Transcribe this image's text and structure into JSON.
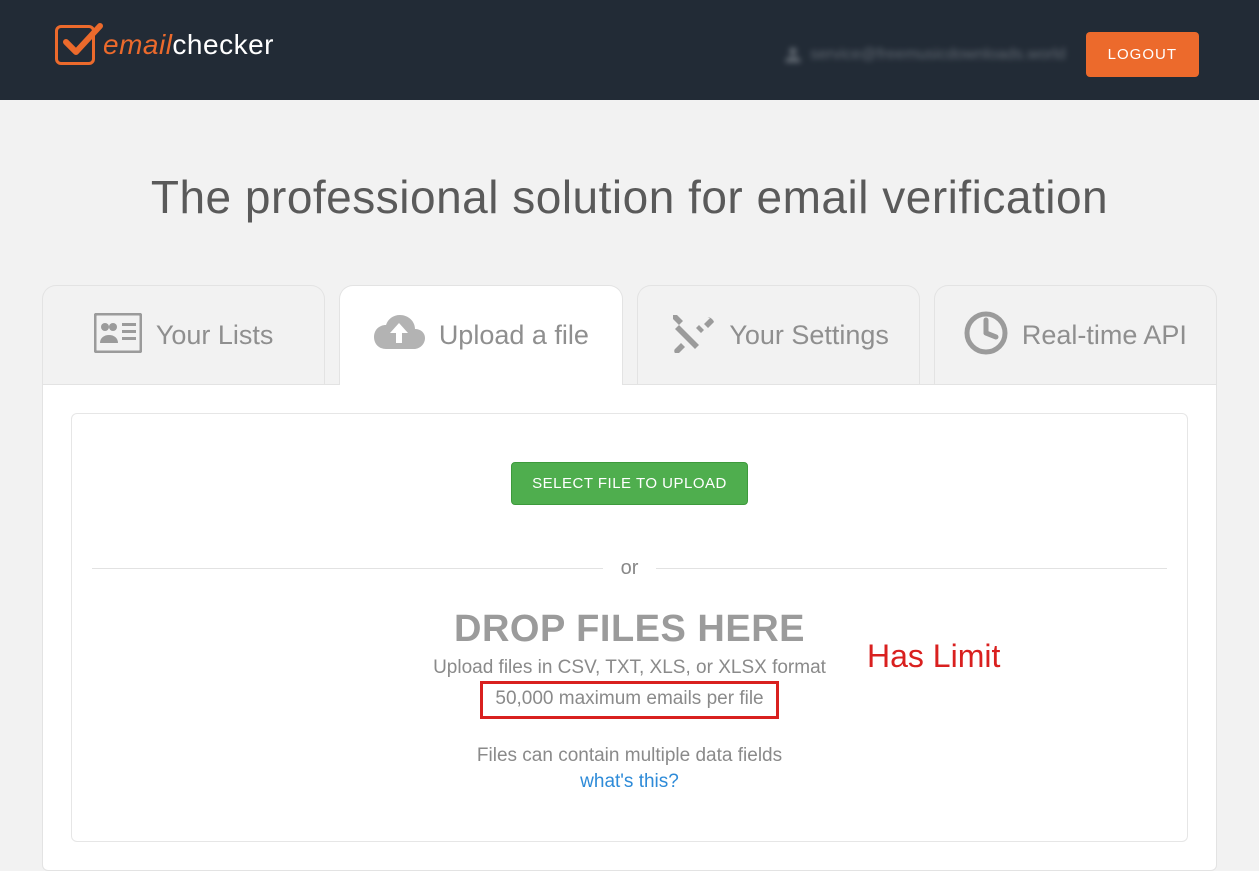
{
  "header": {
    "brand_em": "email",
    "brand_ck": "checker",
    "user_email": "service@freemusicdownloads.world",
    "logout_label": "LOGOUT"
  },
  "hero": {
    "title": "The professional solution for email verification"
  },
  "tabs": {
    "lists": "Your Lists",
    "upload": "Upload a file",
    "settings": "Your Settings",
    "api": "Real-time API"
  },
  "upload": {
    "select_button": "SELECT FILE TO UPLOAD",
    "divider": "or",
    "drop_title": "DROP FILES HERE",
    "formats_line": "Upload files in CSV, TXT, XLS, or XLSX format",
    "limit_line": "50,000 maximum emails per file",
    "multi_line": "Files can contain multiple data fields",
    "whats_this": "what's this?"
  },
  "annotation": {
    "has_limit": "Has Limit"
  }
}
